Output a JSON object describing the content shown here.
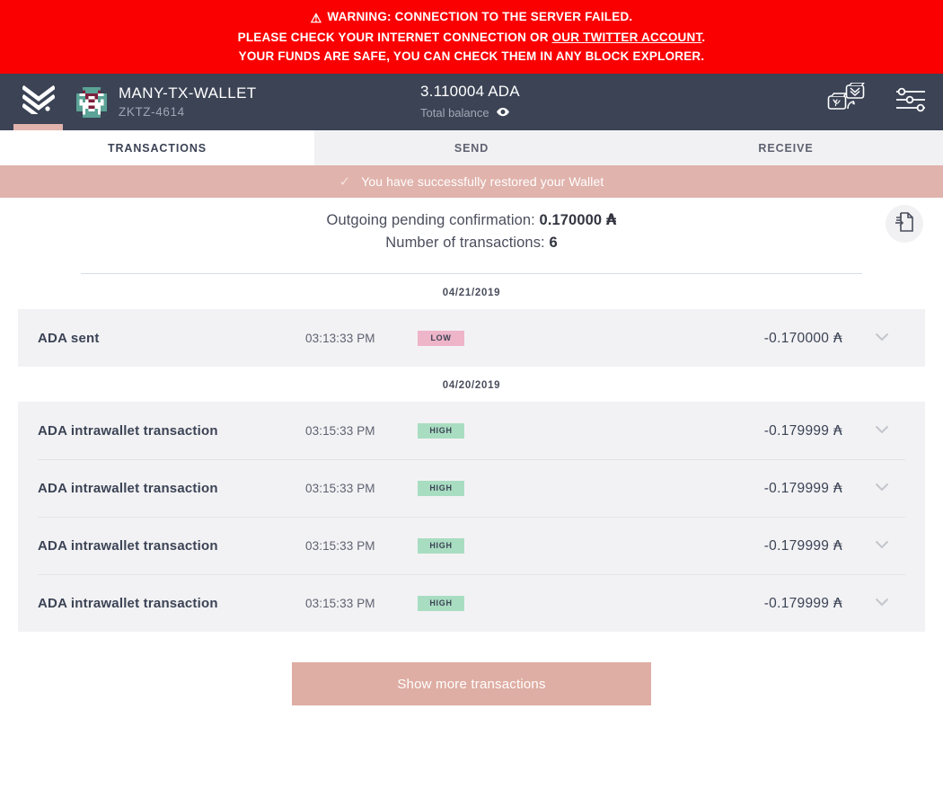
{
  "warning": {
    "icon": "warning-triangle-icon",
    "line1": "WARNING: CONNECTION TO THE SERVER FAILED.",
    "line2_before": "PLEASE CHECK YOUR INTERNET CONNECTION OR ",
    "line2_link": "OUR TWITTER ACCOUNT",
    "line2_after": ".",
    "line3": "YOUR FUNDS ARE SAFE, YOU CAN CHECK THEM IN ANY BLOCK EXPLORER.",
    "background": "#fa0000"
  },
  "topbar": {
    "logo": "daedalus-chevrons-logo",
    "wallet_name": "MANY-TX-WALLET",
    "wallet_id": "ZKTZ-4614",
    "balance_amount": "3.110004 ADA",
    "balance_label": "Total balance",
    "eye_icon": "eye-icon",
    "wallet_switch_icon": "wallet-switch-icon",
    "settings_icon": "settings-sliders-icon",
    "background": "#3b4355"
  },
  "tabs": [
    {
      "label": "TRANSACTIONS",
      "active": true
    },
    {
      "label": "SEND",
      "active": false
    },
    {
      "label": "RECEIVE",
      "active": false
    }
  ],
  "notification": {
    "icon": "check-icon",
    "text": "You have successfully restored your Wallet",
    "background": "#e0b3ac"
  },
  "summary": {
    "pending_label": "Outgoing pending confirmation:",
    "pending_value": "0.170000",
    "ada_symbol": "₳",
    "count_label": "Number of transactions:",
    "count_value": "6",
    "export_icon": "export-file-icon"
  },
  "transaction_groups": [
    {
      "date": "04/21/2019",
      "transactions": [
        {
          "title": "ADA sent",
          "time": "03:13:33 PM",
          "badge": "LOW",
          "badge_type": "low",
          "amount": "-0.170000",
          "ada_symbol": "₳",
          "chevron": "chevron-down-icon"
        }
      ]
    },
    {
      "date": "04/20/2019",
      "transactions": [
        {
          "title": "ADA intrawallet transaction",
          "time": "03:15:33 PM",
          "badge": "HIGH",
          "badge_type": "high",
          "amount": "-0.179999",
          "ada_symbol": "₳",
          "chevron": "chevron-down-icon"
        },
        {
          "title": "ADA intrawallet transaction",
          "time": "03:15:33 PM",
          "badge": "HIGH",
          "badge_type": "high",
          "amount": "-0.179999",
          "ada_symbol": "₳",
          "chevron": "chevron-down-icon"
        },
        {
          "title": "ADA intrawallet transaction",
          "time": "03:15:33 PM",
          "badge": "HIGH",
          "badge_type": "high",
          "amount": "-0.179999",
          "ada_symbol": "₳",
          "chevron": "chevron-down-icon"
        },
        {
          "title": "ADA intrawallet transaction",
          "time": "03:15:33 PM",
          "badge": "HIGH",
          "badge_type": "high",
          "amount": "-0.179999",
          "ada_symbol": "₳",
          "chevron": "chevron-down-icon"
        }
      ]
    }
  ],
  "show_more": {
    "label": "Show more transactions",
    "background": "#deada3"
  },
  "colors": {
    "accent_pink": "#e0b3ac",
    "header_navy": "#3b4355",
    "badge_low": "#eeb4c7",
    "badge_high": "#a9ddc1",
    "row_bg": "#f2f2f4"
  }
}
